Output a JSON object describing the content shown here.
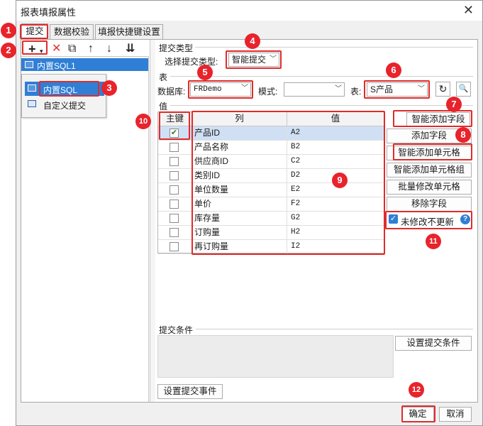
{
  "window": {
    "title": "报表填报属性",
    "close_glyph": "✕"
  },
  "tabs": [
    {
      "label": "提交",
      "active": true
    },
    {
      "label": "数据校验",
      "active": false
    },
    {
      "label": "填报快捷键设置",
      "active": false
    }
  ],
  "toolbar": {
    "add_glyph": "+",
    "dropdown_glyph": "▾",
    "delete_glyph": "✕",
    "copy_glyph": "⧉",
    "up_glyph": "↑",
    "down_glyph": "↓",
    "sort_glyph": "⇊"
  },
  "left_list": {
    "selected_item": "内置SQL1",
    "popup_items": [
      "内置SQL",
      "自定义提交"
    ]
  },
  "submit_type": {
    "section": "提交类型",
    "label": "选择提交类型:",
    "value": "智能提交"
  },
  "table_section": {
    "section": "表",
    "db_label": "数据库:",
    "db_value": "FRDemo",
    "mode_label": "模式:",
    "mode_value": "",
    "table_label": "表:",
    "table_value": "S产品"
  },
  "values_section": {
    "section": "值",
    "columns": [
      "主键",
      "列",
      "值"
    ],
    "rows": [
      {
        "key": true,
        "column": "产品ID",
        "value": "A2"
      },
      {
        "key": false,
        "column": "产品名称",
        "value": "B2"
      },
      {
        "key": false,
        "column": "供应商ID",
        "value": "C2"
      },
      {
        "key": false,
        "column": "类别ID",
        "value": "D2"
      },
      {
        "key": false,
        "column": "单位数量",
        "value": "E2"
      },
      {
        "key": false,
        "column": "单价",
        "value": "F2"
      },
      {
        "key": false,
        "column": "库存量",
        "value": "G2"
      },
      {
        "key": false,
        "column": "订购量",
        "value": "H2"
      },
      {
        "key": false,
        "column": "再订购量",
        "value": "I2"
      }
    ]
  },
  "side_buttons": {
    "smart_add_field": "智能添加字段",
    "add_field": "添加字段",
    "smart_add_cell": "智能添加单元格",
    "smart_add_cell_group": "智能添加单元格组",
    "batch_modify_cell": "批量修改单元格",
    "remove_field": "移除字段",
    "no_update_unmodified": "未修改不更新",
    "help_glyph": "?"
  },
  "condition": {
    "section": "提交条件",
    "set_condition_button": "设置提交条件"
  },
  "set_event_button": "设置提交事件",
  "footer": {
    "ok": "确定",
    "cancel": "取消"
  },
  "badges": [
    "1",
    "2",
    "3",
    "4",
    "5",
    "6",
    "7",
    "8",
    "9",
    "10",
    "11",
    "12"
  ],
  "colors": {
    "accent": "#2f7fd6",
    "callout": "#e8232b"
  }
}
